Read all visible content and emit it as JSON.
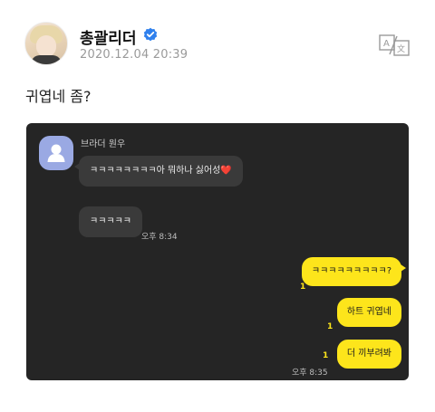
{
  "post": {
    "author_name": "총괄리더",
    "timestamp": "2020.12.04 20:39",
    "text": "귀엽네 좀?",
    "verified_icon": "verified-badge-icon",
    "translate_icon": "translate-icon",
    "accent_color": "#2f80ed"
  },
  "chat": {
    "sender_name": "브라더 원우",
    "incoming": [
      {
        "text": "ㅋㅋㅋㅋㅋㅋㅋㅋ아 뭐하나 싫어성",
        "emoji": "❤️"
      },
      {
        "text": "ㅋㅋㅋㅋㅋ"
      }
    ],
    "incoming_time": "오후 8:34",
    "outgoing": [
      {
        "text": "ㅋㅋㅋㅋㅋㅋㅋㅋㅋ?",
        "read": "1"
      },
      {
        "text": "하트 귀엽네",
        "read": "1"
      },
      {
        "text": "더 끼부려봐",
        "read": "1"
      }
    ],
    "outgoing_time": "오후 8:35",
    "bubble_color": "#fde51b",
    "background_color": "#252525"
  }
}
